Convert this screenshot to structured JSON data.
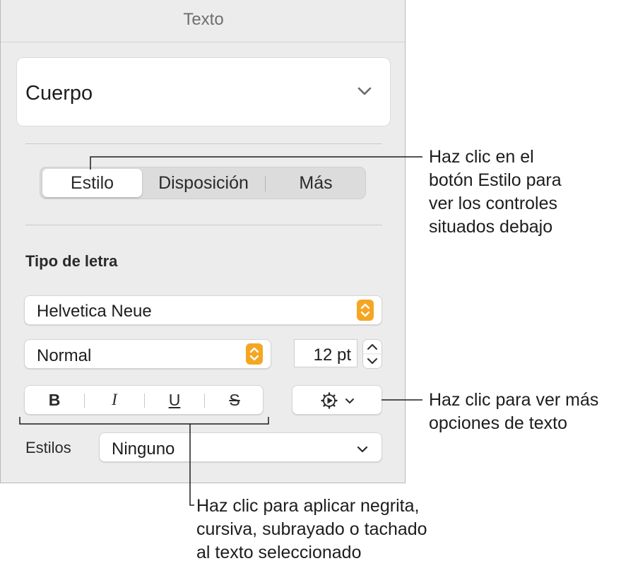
{
  "panel": {
    "title": "Texto",
    "paragraph_style": "Cuerpo",
    "tabs": [
      {
        "label": "Estilo",
        "active": true
      },
      {
        "label": "Disposición",
        "active": false
      },
      {
        "label": "Más",
        "active": false
      }
    ],
    "font_section": {
      "heading": "Tipo de letra",
      "font_family": "Helvetica Neue",
      "typeface": "Normal",
      "size": "12 pt"
    },
    "format_buttons": [
      {
        "label": "B",
        "action": "bold"
      },
      {
        "label": "I",
        "action": "italic"
      },
      {
        "label": "U",
        "action": "underline"
      },
      {
        "label": "S",
        "action": "strikethrough"
      }
    ],
    "styles": {
      "label": "Estilos",
      "value": "Ninguno"
    },
    "accent_color": "#f4a623"
  },
  "callouts": {
    "style_button": [
      "Haz clic en el",
      "botón Estilo para",
      "ver los controles",
      "situados debajo"
    ],
    "more_options": [
      "Haz clic para ver más",
      "opciones de texto"
    ],
    "formatting": [
      "Haz clic para aplicar negrita,",
      "cursiva, subrayado o tachado",
      "al texto seleccionado"
    ]
  }
}
